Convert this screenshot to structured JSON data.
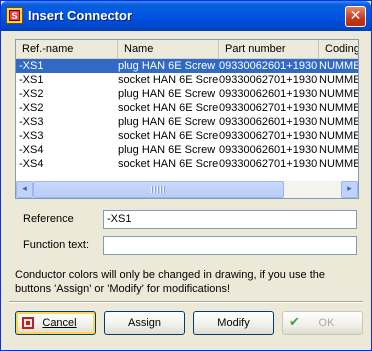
{
  "window": {
    "title": "Insert Connector",
    "close_glyph": "✕",
    "app_icon": "app-icon"
  },
  "list": {
    "columns": [
      "Ref.-name",
      "Name",
      "Part number",
      "Coding"
    ],
    "rows": [
      {
        "ref": "-XS1",
        "name": "plug HAN 6E Screw",
        "part": "09330062601+1930",
        "coding": "NUMMER",
        "selected": true
      },
      {
        "ref": "-XS1",
        "name": "socket HAN 6E Scre",
        "part": "09330062701+1930",
        "coding": "NUMMER",
        "selected": false
      },
      {
        "ref": "-XS2",
        "name": "plug HAN 6E Screw",
        "part": "09330062601+1930",
        "coding": "NUMMER",
        "selected": false
      },
      {
        "ref": "-XS2",
        "name": "socket HAN 6E Scre",
        "part": "09330062701+1930",
        "coding": "NUMMER",
        "selected": false
      },
      {
        "ref": "-XS3",
        "name": "plug HAN 6E Screw",
        "part": "09330062601+1930",
        "coding": "NUMMER",
        "selected": false
      },
      {
        "ref": "-XS3",
        "name": "socket HAN 6E Scre",
        "part": "09330062701+1930",
        "coding": "NUMMER",
        "selected": false
      },
      {
        "ref": "-XS4",
        "name": "plug HAN 6E Screw",
        "part": "09330062601+1930",
        "coding": "NUMMER",
        "selected": false
      },
      {
        "ref": "-XS4",
        "name": "socket HAN 6E Scre",
        "part": "09330062701+1930",
        "coding": "NUMMER",
        "selected": false
      }
    ],
    "scroll_left_glyph": "◂",
    "scroll_right_glyph": "▸"
  },
  "form": {
    "reference_label": "Reference",
    "reference_value": "-XS1",
    "function_label": "Function text:",
    "function_value": ""
  },
  "info_text": "Conductor colors will only be changed in drawing, if you use the buttons 'Assign' or 'Modify' for modifications!",
  "buttons": {
    "cancel": "Cancel",
    "assign": "Assign",
    "modify": "Modify",
    "ok": "OK",
    "ok_glyph": "✔"
  },
  "colors": {
    "selection": "#316ac5",
    "title_bar": "#0054e3",
    "dialog_bg": "#ece9d8"
  }
}
